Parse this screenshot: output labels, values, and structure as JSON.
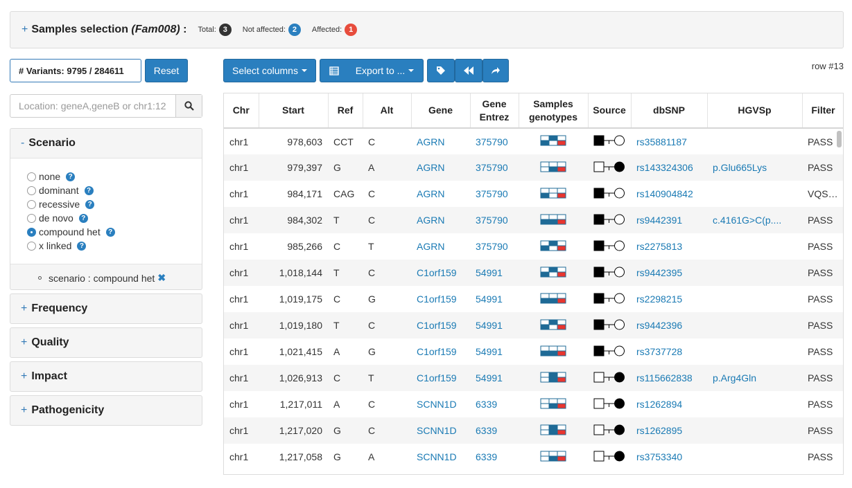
{
  "samples": {
    "title": "Samples selection",
    "family": "(Fam008)",
    "colon": ":",
    "counts": [
      {
        "label": "Total:",
        "value": "3",
        "color": "#333333"
      },
      {
        "label": "Not affected:",
        "value": "2",
        "color": "#2a7fbf"
      },
      {
        "label": "Affected:",
        "value": "1",
        "color": "#e74c3c"
      }
    ]
  },
  "sidebar": {
    "variants": "# Variants: 9795 / 284611",
    "reset": "Reset",
    "location_placeholder": "Location: geneA,geneB or chr1:12",
    "scenario": {
      "title": "Scenario",
      "sign": "-",
      "options": [
        {
          "label": "none",
          "checked": false
        },
        {
          "label": "dominant",
          "checked": false
        },
        {
          "label": "recessive",
          "checked": false
        },
        {
          "label": "de novo",
          "checked": false
        },
        {
          "label": "compound het",
          "checked": true
        },
        {
          "label": "x linked",
          "checked": false
        }
      ],
      "active_filter": "scenario : compound het"
    },
    "panels": [
      {
        "title": "Frequency",
        "sign": "+"
      },
      {
        "title": "Quality",
        "sign": "+"
      },
      {
        "title": "Impact",
        "sign": "+"
      },
      {
        "title": "Pathogenicity",
        "sign": "+"
      }
    ]
  },
  "toolbar": {
    "select_columns": "Select columns",
    "export": "Export to ...",
    "row_indicator": "row #13"
  },
  "table": {
    "headers": [
      "Chr",
      "Start",
      "Ref",
      "Alt",
      "Gene",
      "Gene Entrez",
      "Samples genotypes",
      "Source",
      "dbSNP",
      "HGVSp",
      "Filter"
    ],
    "rows": [
      {
        "chr": "chr1",
        "start": "978,603",
        "ref": "CCT",
        "alt": "C",
        "gene": "AGRN",
        "entrez": "375790",
        "geno": [
          [
            "w",
            "b"
          ],
          [
            "b",
            "w"
          ],
          [
            "w",
            "r"
          ]
        ],
        "source": "filled",
        "dbsnp": "rs35881187",
        "hgvsp": "",
        "filter": "PASS"
      },
      {
        "chr": "chr1",
        "start": "979,397",
        "ref": "G",
        "alt": "A",
        "gene": "AGRN",
        "entrez": "375790",
        "geno": [
          [
            "w",
            "w"
          ],
          [
            "w",
            "b"
          ],
          [
            "w",
            "r"
          ]
        ],
        "source": "open",
        "dbsnp": "rs143324306",
        "hgvsp": "p.Glu665Lys",
        "filter": "PASS"
      },
      {
        "chr": "chr1",
        "start": "984,171",
        "ref": "CAG",
        "alt": "C",
        "gene": "AGRN",
        "entrez": "375790",
        "geno": [
          [
            "w",
            "b"
          ],
          [
            "w",
            "w"
          ],
          [
            "w",
            "r"
          ]
        ],
        "source": "filled",
        "dbsnp": "rs140904842",
        "hgvsp": "",
        "filter": "VQSRTr..."
      },
      {
        "chr": "chr1",
        "start": "984,302",
        "ref": "T",
        "alt": "C",
        "gene": "AGRN",
        "entrez": "375790",
        "geno": [
          [
            "w",
            "b"
          ],
          [
            "w",
            "b"
          ],
          [
            "w",
            "r"
          ]
        ],
        "source": "filled",
        "dbsnp": "rs9442391",
        "hgvsp": "c.4161G>C(p....",
        "filter": "PASS"
      },
      {
        "chr": "chr1",
        "start": "985,266",
        "ref": "C",
        "alt": "T",
        "gene": "AGRN",
        "entrez": "375790",
        "geno": [
          [
            "w",
            "b"
          ],
          [
            "b",
            "w"
          ],
          [
            "w",
            "r"
          ]
        ],
        "source": "filled",
        "dbsnp": "rs2275813",
        "hgvsp": "",
        "filter": "PASS"
      },
      {
        "chr": "chr1",
        "start": "1,018,144",
        "ref": "T",
        "alt": "C",
        "gene": "C1orf159",
        "entrez": "54991",
        "geno": [
          [
            "w",
            "b"
          ],
          [
            "b",
            "w"
          ],
          [
            "w",
            "r"
          ]
        ],
        "source": "filled",
        "dbsnp": "rs9442395",
        "hgvsp": "",
        "filter": "PASS"
      },
      {
        "chr": "chr1",
        "start": "1,019,175",
        "ref": "C",
        "alt": "G",
        "gene": "C1orf159",
        "entrez": "54991",
        "geno": [
          [
            "w",
            "b"
          ],
          [
            "w",
            "b"
          ],
          [
            "w",
            "r"
          ]
        ],
        "source": "filled",
        "dbsnp": "rs2298215",
        "hgvsp": "",
        "filter": "PASS"
      },
      {
        "chr": "chr1",
        "start": "1,019,180",
        "ref": "T",
        "alt": "C",
        "gene": "C1orf159",
        "entrez": "54991",
        "geno": [
          [
            "w",
            "b"
          ],
          [
            "b",
            "w"
          ],
          [
            "w",
            "r"
          ]
        ],
        "source": "filled",
        "dbsnp": "rs9442396",
        "hgvsp": "",
        "filter": "PASS"
      },
      {
        "chr": "chr1",
        "start": "1,021,415",
        "ref": "A",
        "alt": "G",
        "gene": "C1orf159",
        "entrez": "54991",
        "geno": [
          [
            "w",
            "b"
          ],
          [
            "w",
            "b"
          ],
          [
            "w",
            "r"
          ]
        ],
        "source": "filled",
        "dbsnp": "rs3737728",
        "hgvsp": "",
        "filter": "PASS"
      },
      {
        "chr": "chr1",
        "start": "1,026,913",
        "ref": "C",
        "alt": "T",
        "gene": "C1orf159",
        "entrez": "54991",
        "geno": [
          [
            "w",
            "w"
          ],
          [
            "b",
            "b"
          ],
          [
            "w",
            "r"
          ]
        ],
        "source": "open",
        "dbsnp": "rs115662838",
        "hgvsp": "p.Arg4Gln",
        "filter": "PASS"
      },
      {
        "chr": "chr1",
        "start": "1,217,011",
        "ref": "A",
        "alt": "C",
        "gene": "SCNN1D",
        "entrez": "6339",
        "geno": [
          [
            "w",
            "w"
          ],
          [
            "w",
            "b"
          ],
          [
            "w",
            "r"
          ]
        ],
        "source": "open",
        "dbsnp": "rs1262894",
        "hgvsp": "",
        "filter": "PASS"
      },
      {
        "chr": "chr1",
        "start": "1,217,020",
        "ref": "G",
        "alt": "C",
        "gene": "SCNN1D",
        "entrez": "6339",
        "geno": [
          [
            "w",
            "w"
          ],
          [
            "b",
            "b"
          ],
          [
            "w",
            "r"
          ]
        ],
        "source": "open",
        "dbsnp": "rs1262895",
        "hgvsp": "",
        "filter": "PASS"
      },
      {
        "chr": "chr1",
        "start": "1,217,058",
        "ref": "G",
        "alt": "A",
        "gene": "SCNN1D",
        "entrez": "6339",
        "geno": [
          [
            "w",
            "w"
          ],
          [
            "w",
            "b"
          ],
          [
            "w",
            "r"
          ]
        ],
        "source": "open",
        "dbsnp": "rs3753340",
        "hgvsp": "",
        "filter": "PASS"
      }
    ]
  },
  "colors": {
    "primary": "#2a7fbf",
    "link": "#1a7ab4",
    "genotype_blue": "#1e6a96",
    "genotype_red": "#e8352f"
  }
}
